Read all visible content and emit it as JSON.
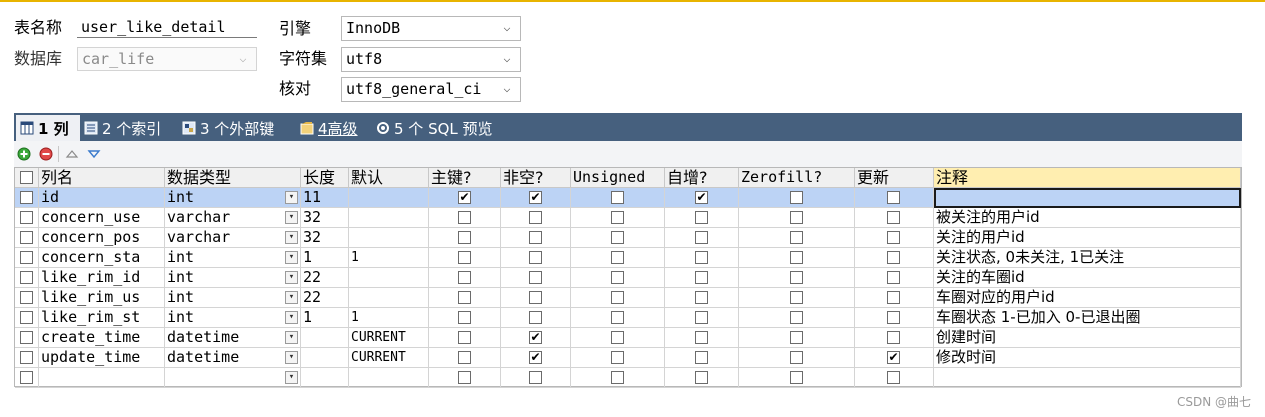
{
  "form": {
    "table_name_label": "表名称",
    "table_name_value": "user_like_detail",
    "database_label": "数据库",
    "database_value": "car_life",
    "engine_label": "引擎",
    "engine_value": "InnoDB",
    "charset_label": "字符集",
    "charset_value": "utf8",
    "collation_label": "核对",
    "collation_value": "utf8_general_ci"
  },
  "tabs": [
    {
      "label": "1 列",
      "icon": "columns-icon",
      "active": true
    },
    {
      "label": "2 个索引",
      "icon": "index-icon",
      "active": false
    },
    {
      "label": "3 个外部键",
      "icon": "foreign-key-icon",
      "active": false
    },
    {
      "label": "4高级",
      "icon": "advanced-icon",
      "active": false
    },
    {
      "label": "5 个 SQL 预览",
      "icon": "sql-preview-icon",
      "active": false
    }
  ],
  "toolbar": {
    "add_icon": "add-circle-icon",
    "remove_icon": "remove-circle-icon",
    "up_icon": "move-up-icon",
    "down_icon": "move-down-icon"
  },
  "columns": {
    "name": "列名",
    "type": "数据类型",
    "length": "长度",
    "default": "默认",
    "pk": "主键?",
    "notnull": "非空?",
    "unsigned": "Unsigned",
    "autoinc": "自增?",
    "zerofill": "Zerofill?",
    "update": "更新",
    "comment": "注释"
  },
  "rows": [
    {
      "name": "id",
      "type": "int",
      "length": "11",
      "default": "",
      "pk": true,
      "notnull": true,
      "unsigned": false,
      "autoinc": true,
      "zerofill": false,
      "update": false,
      "comment": ""
    },
    {
      "name": "concern_use",
      "type": "varchar",
      "length": "32",
      "default": "",
      "pk": false,
      "notnull": false,
      "unsigned": false,
      "autoinc": false,
      "zerofill": false,
      "update": false,
      "comment": "被关注的用户id"
    },
    {
      "name": "concern_pos",
      "type": "varchar",
      "length": "32",
      "default": "",
      "pk": false,
      "notnull": false,
      "unsigned": false,
      "autoinc": false,
      "zerofill": false,
      "update": false,
      "comment": "关注的用户id"
    },
    {
      "name": "concern_sta",
      "type": "int",
      "length": "1",
      "default": "1",
      "pk": false,
      "notnull": false,
      "unsigned": false,
      "autoinc": false,
      "zerofill": false,
      "update": false,
      "comment": "关注状态, 0未关注, 1已关注"
    },
    {
      "name": "like_rim_id",
      "type": "int",
      "length": "22",
      "default": "",
      "pk": false,
      "notnull": false,
      "unsigned": false,
      "autoinc": false,
      "zerofill": false,
      "update": false,
      "comment": "关注的车圈id"
    },
    {
      "name": "like_rim_us",
      "type": "int",
      "length": "22",
      "default": "",
      "pk": false,
      "notnull": false,
      "unsigned": false,
      "autoinc": false,
      "zerofill": false,
      "update": false,
      "comment": "车圈对应的用户id"
    },
    {
      "name": "like_rim_st",
      "type": "int",
      "length": "1",
      "default": "1",
      "pk": false,
      "notnull": false,
      "unsigned": false,
      "autoinc": false,
      "zerofill": false,
      "update": false,
      "comment": "车圈状态 1-已加入 0-已退出圈"
    },
    {
      "name": "create_time",
      "type": "datetime",
      "length": "",
      "default": "CURRENT",
      "pk": false,
      "notnull": true,
      "unsigned": false,
      "autoinc": false,
      "zerofill": false,
      "update": false,
      "comment": "创建时间"
    },
    {
      "name": "update_time",
      "type": "datetime",
      "length": "",
      "default": "CURRENT",
      "pk": false,
      "notnull": true,
      "unsigned": false,
      "autoinc": false,
      "zerofill": false,
      "update": true,
      "comment": "修改时间"
    },
    {
      "name": "",
      "type": "",
      "length": "",
      "default": "",
      "pk": false,
      "notnull": false,
      "unsigned": false,
      "autoinc": false,
      "zerofill": false,
      "update": false,
      "comment": ""
    }
  ],
  "watermark": "CSDN @曲七",
  "colors": {
    "tabbar": "#46607e",
    "selected_row": "#bcd3f5",
    "comment_header": "#ffeeb0",
    "accent_line": "#e8b400"
  }
}
